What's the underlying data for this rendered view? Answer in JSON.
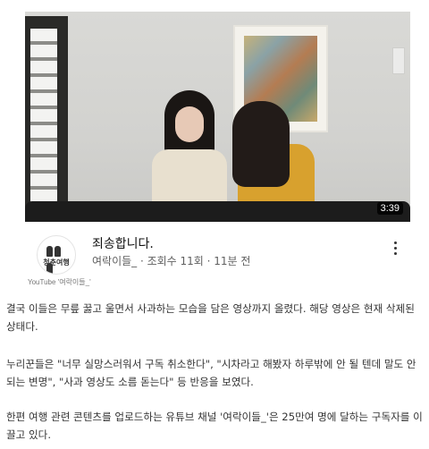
{
  "video": {
    "duration": "3:39",
    "title": "죄송합니다.",
    "meta": "여락이들_ · 조회수 11회 · 11분 전",
    "channel_logo_text": "청춘여행"
  },
  "source_caption": "YouTube '여락이들_'",
  "article": {
    "paragraphs": [
      "결국 이들은 무릎 꿇고 울면서 사과하는 모습을 담은 영상까지 올렸다. 해당 영상은 현재 삭제된 상태다.",
      "누리꾼들은 \"너무 실망스러워서 구독 취소한다\", \"시차라고 해봤자 하루밖에 안 될 텐데 말도 안 되는 변명\", \"사과 영상도 소름 돋는다\" 등 반응을 보였다.",
      "한편 여행 관련 콘텐츠를 업로드하는 유튜브 채널 '여락이들_'은 25만여 명에 달하는 구독자를 이끌고 있다."
    ]
  },
  "icons": {
    "more": "more-vertical-icon"
  }
}
